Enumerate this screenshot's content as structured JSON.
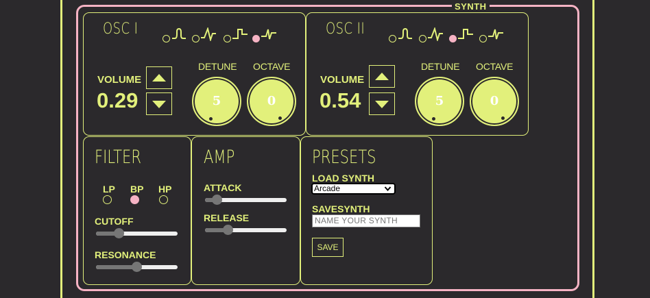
{
  "synth_title": "SYNTH",
  "colors": {
    "accent": "#e2f07b",
    "highlight": "#f6b3c4",
    "background": "#2b292c"
  },
  "osc1": {
    "title": "OSC I",
    "waveforms": [
      "sine",
      "triangle",
      "square",
      "sawtooth"
    ],
    "selected_waveform": "sawtooth",
    "volume_label": "VOLUME",
    "volume_value": "0.29",
    "detune_label": "DETUNE",
    "detune_value": "5",
    "octave_label": "OCTAVE",
    "octave_value": "0"
  },
  "osc2": {
    "title": "OSC II",
    "waveforms": [
      "sine",
      "triangle",
      "square",
      "sawtooth"
    ],
    "selected_waveform": "square",
    "volume_label": "VOLUME",
    "volume_value": "0.54",
    "detune_label": "DETUNE",
    "detune_value": "5",
    "octave_label": "OCTAVE",
    "octave_value": "0"
  },
  "filter": {
    "title": "FILTER",
    "types": [
      "LP",
      "BP",
      "HP"
    ],
    "selected_type": "BP",
    "cutoff_label": "CUTOFF",
    "cutoff_level": 0.25,
    "resonance_label": "RESONANCE",
    "resonance_level": 0.5
  },
  "amp": {
    "title": "AMP",
    "attack_label": "ATTACK",
    "attack_level": 0.1,
    "release_label": "RELEASE",
    "release_level": 0.25
  },
  "presets": {
    "title": "PRESETS",
    "load_label": "LOAD SYNTH",
    "selected_preset": "Arcade",
    "save_label": "SAVESYNTH",
    "name_placeholder": "NAME YOUR SYNTH",
    "save_button": "SAVE"
  }
}
